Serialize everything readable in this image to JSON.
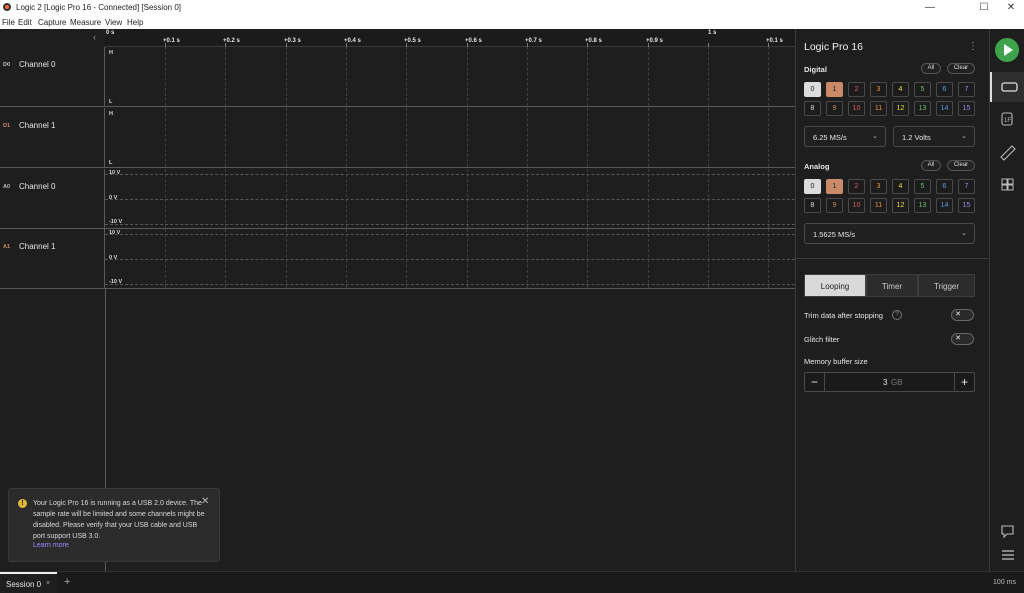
{
  "window": {
    "title": "Logic 2 [Logic Pro 16 - Connected] [Session 0]",
    "minimize": "—",
    "maximize": "☐",
    "close": "✕"
  },
  "menu": [
    "File",
    "Edit",
    "Capture",
    "Measure",
    "View",
    "Help"
  ],
  "ruler": {
    "collapse_arrow": "‹",
    "start": "0 s",
    "second_marker": "1 s",
    "ticks": [
      "+0.1 s",
      "+0.2 s",
      "+0.3 s",
      "+0.4 s",
      "+0.5 s",
      "+0.6 s",
      "+0.7 s",
      "+0.8 s",
      "+0.9 s",
      "+0.1 s"
    ]
  },
  "channels": [
    {
      "id": "D0",
      "name": "Channel 0",
      "type": "digital",
      "high": "H",
      "low": "L",
      "id_color": "#bdbdbd"
    },
    {
      "id": "D1",
      "name": "Channel 1",
      "type": "digital",
      "high": "H",
      "low": "L",
      "id_color": "#c98a6a"
    },
    {
      "id": "A0",
      "name": "Channel 0",
      "type": "analog",
      "top": "10 V",
      "mid": "0 V",
      "bottom": "-10 V",
      "id_color": "#bdbdbd"
    },
    {
      "id": "A1",
      "name": "Channel 1",
      "type": "analog",
      "top": "10 V",
      "mid": "0 V",
      "bottom": "-10 V",
      "id_color": "#c98a6a"
    }
  ],
  "panel": {
    "device_name": "Logic Pro 16",
    "menu_icon": "⋮",
    "digital_label": "Digital",
    "analog_label": "Analog",
    "all_label": "All",
    "clear_label": "Clear",
    "channel_numbers": [
      "0",
      "1",
      "2",
      "3",
      "4",
      "5",
      "6",
      "7",
      "8",
      "9",
      "10",
      "11",
      "12",
      "13",
      "14",
      "15"
    ],
    "channel_colors": [
      "#dcdcdc",
      "#c98a6a",
      "#e05a5a",
      "#e8943a",
      "#e8e04a",
      "#6ac16a",
      "#5a9ae8",
      "#9a8ae8",
      "#dcdcdc",
      "#c98a6a",
      "#e05a5a",
      "#e8943a",
      "#e8e04a",
      "#6ac16a",
      "#5a9ae8",
      "#9a8ae8"
    ],
    "digital_selected": [
      0,
      1
    ],
    "analog_selected": [
      0,
      1
    ],
    "digital_sample_rate": "6.25 MS/s",
    "voltage": "1.2 Volts",
    "analog_sample_rate": "1.5625 MS/s",
    "mode_tabs": [
      "Looping",
      "Timer",
      "Trigger"
    ],
    "active_tab": "Looping",
    "trim_label": "Trim data after stopping",
    "help_glyph": "?",
    "glitch_label": "Glitch filter",
    "toggle_glyph": "✕",
    "memory_label": "Memory buffer size",
    "memory_value": "3",
    "memory_unit": "GB",
    "minus_glyph": "−",
    "plus_glyph": "+"
  },
  "toast": {
    "icon": "!",
    "message": "Your Logic Pro 16 is running as a USB 2.0 device. The sample rate will be limited and some channels might be disabled. Please verify that your USB cable and USB port support USB 3.0.",
    "link": "Learn more",
    "close": "✕"
  },
  "bottom": {
    "session_label": "Session 0",
    "session_close": "×",
    "add_tab": "+",
    "zoom": "100 ms"
  }
}
